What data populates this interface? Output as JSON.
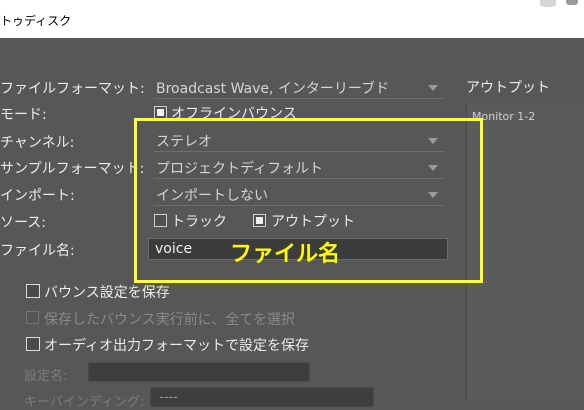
{
  "window": {
    "title": "トゥディスク"
  },
  "form": {
    "file_format": {
      "label": "ファイルフォーマット:",
      "value": "Broadcast Wave, インターリーブド"
    },
    "mode": {
      "label": "モード:",
      "option": "オフラインバウンス",
      "checked": true
    },
    "channel": {
      "label": "チャンネル:",
      "value": "ステレオ"
    },
    "sample_format": {
      "label": "サンプルフォーマット:",
      "value": "プロジェクトディフォルト"
    },
    "import": {
      "label": "インポート:",
      "value": "インポートしない"
    },
    "source": {
      "label": "ソース:",
      "track": {
        "label": "トラック",
        "checked": false
      },
      "output": {
        "label": "アウトプット",
        "checked": true
      }
    },
    "filename": {
      "label": "ファイル名:",
      "value": "voice"
    }
  },
  "options": {
    "save_bounce_settings": {
      "label": "バウンス設定を保存",
      "checked": false
    },
    "select_all_before": {
      "label": "保存したバウンス実行前に、全てを選択",
      "checked": false,
      "enabled": false
    },
    "save_with_audio_format": {
      "label": "オーディオ出力フォーマットで設定を保存",
      "checked": false
    },
    "preset_name": {
      "label": "設定名:"
    },
    "key_binding": {
      "label": "キーバインディング:",
      "value": "----"
    }
  },
  "output_panel": {
    "title": "アウトプット",
    "items": [
      "Monitor 1-2"
    ]
  },
  "annotation": {
    "text": "ファイル名",
    "color": "#ffff00"
  }
}
